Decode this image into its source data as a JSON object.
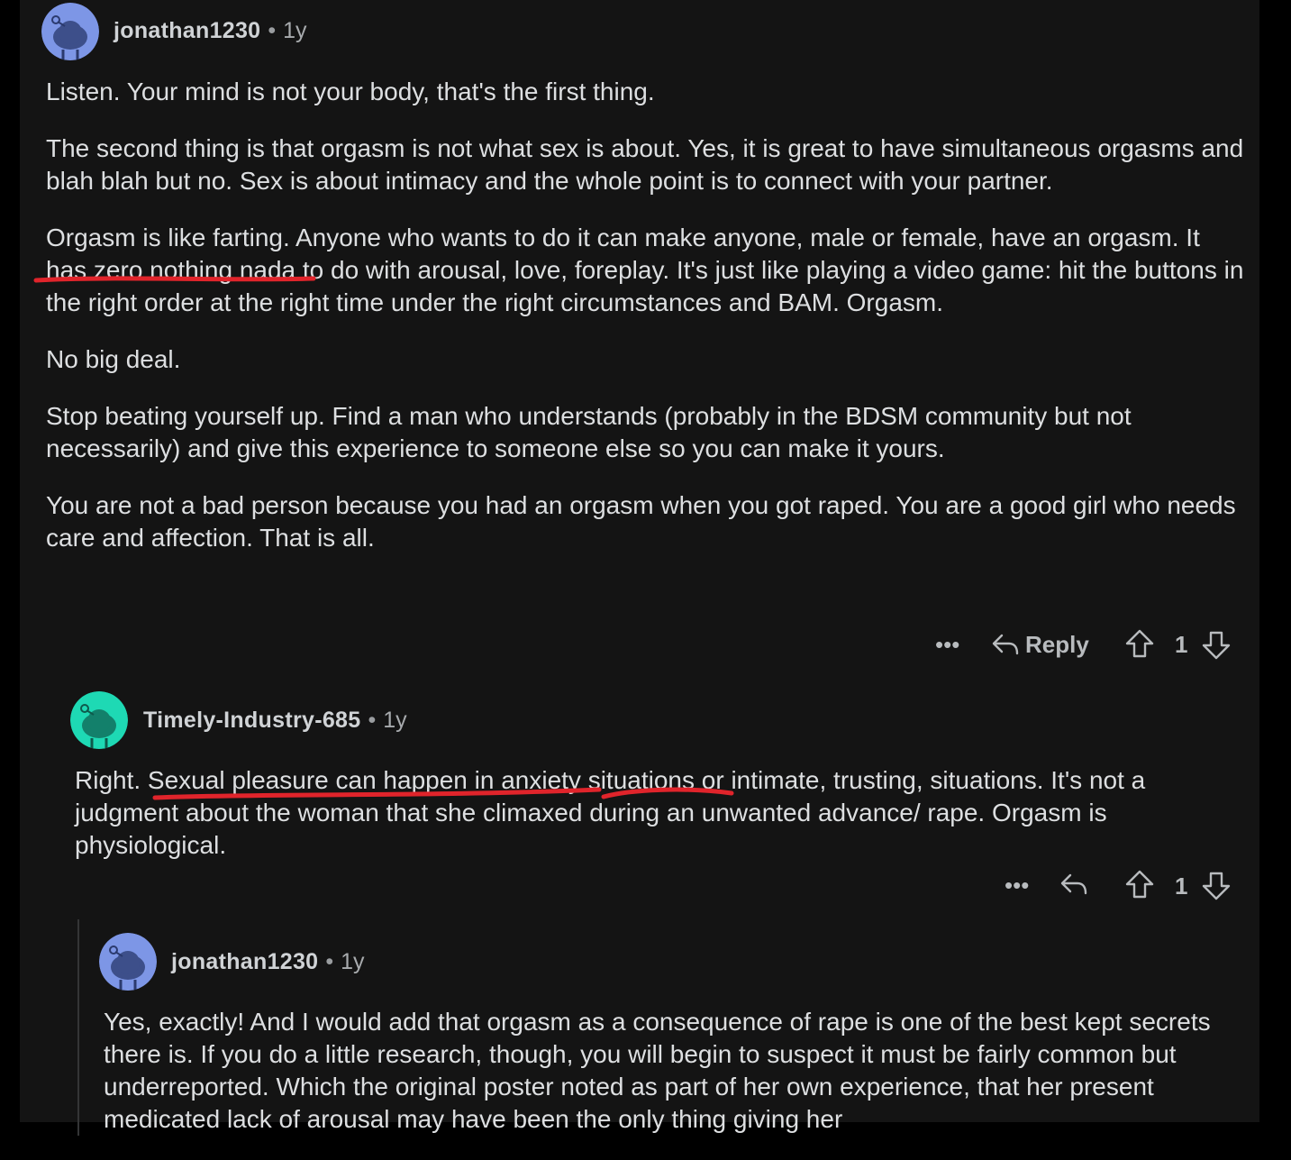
{
  "comments": [
    {
      "username": "jonathan1230",
      "separator": "•",
      "age": "1y",
      "avatar_icon": "reddit-snoo-avatar-icon",
      "avatar_color": "#7d96e6",
      "paragraphs": [
        "Listen. Your mind is not your body, that's the first thing.",
        "The second thing is that orgasm is not what sex is about. Yes, it is great to have simultaneous orgasms and blah blah but no. Sex is about intimacy and the whole point is to connect with your partner.",
        "Orgasm is like farting. Anyone who wants to do it can make anyone, male or female, have an orgasm. It has zero nothing nada to do with arousal, love, foreplay. It's just like playing a video game: hit the buttons in the right order at the right time under the right circumstances and BAM. Orgasm.",
        "No big deal.",
        "Stop beating yourself up. Find a man who understands (probably in the BDSM community but not necessarily) and give this experience to someone else so you can make it yours.",
        "You are not a bad person because you had an orgasm when you got raped. You are a good girl who needs care and affection. That is all."
      ],
      "actions": {
        "more": "•••",
        "reply": "Reply",
        "score": "1"
      }
    },
    {
      "username": "Timely-Industry-685",
      "separator": "•",
      "age": "1y",
      "avatar_icon": "reddit-snoo-avatar-icon",
      "avatar_color": "#1ed9b4",
      "paragraphs": [
        "Right. Sexual pleasure can happen in anxiety situations or intimate, trusting, situations. It's not a judgment about the woman that she climaxed during an unwanted advance/ rape. Orgasm is physiological."
      ],
      "actions": {
        "more": "•••",
        "score": "1"
      }
    },
    {
      "username": "jonathan1230",
      "separator": "•",
      "age": "1y",
      "avatar_icon": "reddit-snoo-avatar-icon",
      "avatar_color": "#7d96e6",
      "paragraphs": [
        "Yes, exactly! And I would add that orgasm as a consequence of rape is one of the best kept secrets there is. If you do a little research, though, you will begin to suspect it must be fairly common but underreported. Which the original poster noted as part of her own experience, that her present medicated lack of arousal may have been the only thing giving her"
      ]
    }
  ],
  "colors": {
    "background": "#141414",
    "text": "#dddfe1",
    "muted": "#b0b3b8",
    "annotation_red": "#e0242b"
  }
}
